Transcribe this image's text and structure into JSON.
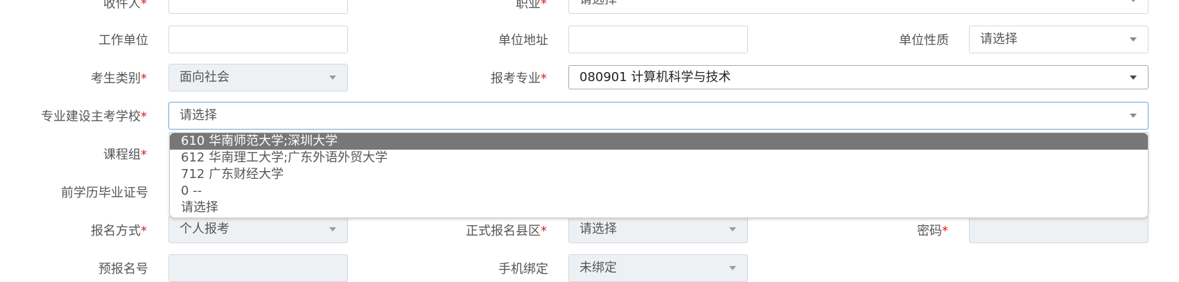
{
  "form": {
    "recipient": {
      "label": "收件人",
      "value": ""
    },
    "occupation": {
      "label": "职业",
      "value": "请选择"
    },
    "work_unit": {
      "label": "工作单位",
      "value": ""
    },
    "unit_address": {
      "label": "单位地址",
      "value": ""
    },
    "unit_type": {
      "label": "单位性质",
      "value": "请选择"
    },
    "candidate_type": {
      "label": "考生类别",
      "value": "面向社会"
    },
    "major": {
      "label": "报考专业",
      "value": "080901 计算机科学与技术"
    },
    "school": {
      "label": "专业建设主考学校",
      "value": "请选择"
    },
    "course_group": {
      "label": "课程组"
    },
    "prev_cert": {
      "label": "前学历毕业证号"
    },
    "reg_method": {
      "label": "报名方式",
      "value": "个人报考"
    },
    "county": {
      "label": "正式报名县区",
      "value": "请选择"
    },
    "password": {
      "label": "密码",
      "value": ""
    },
    "pre_reg_no": {
      "label": "预报名号",
      "value": ""
    },
    "phone_binding": {
      "label": "手机绑定",
      "value": "未绑定"
    },
    "required_mark": "*"
  },
  "school_dropdown": {
    "options": [
      {
        "label": "610 华南师范大学;深圳大学",
        "selected": true
      },
      {
        "label": "612 华南理工大学;广东外语外贸大学",
        "selected": false
      },
      {
        "label": "712 广东财经大学",
        "selected": false
      },
      {
        "label": "0 --",
        "selected": false
      },
      {
        "label": "请选择",
        "selected": false
      }
    ]
  },
  "colors": {
    "required": "#e02020",
    "highlight": "#777777",
    "focus_border": "#66a7e0",
    "disabled_bg": "#eef1f4"
  },
  "icons": {
    "select_caret": "chevron-down-icon"
  }
}
